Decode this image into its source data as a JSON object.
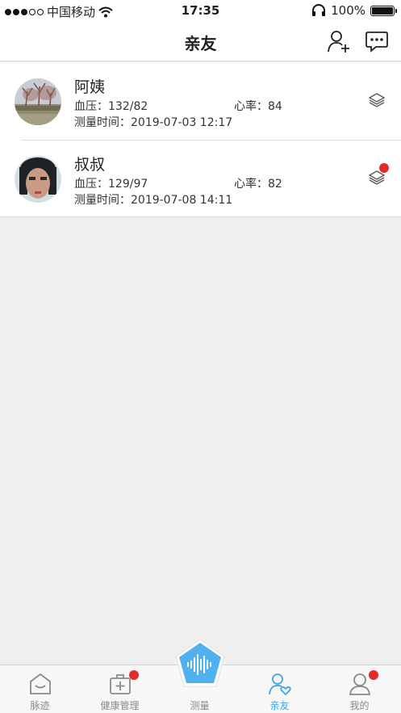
{
  "status": {
    "carrier": "中国移动",
    "time": "17:35",
    "battery": "100%"
  },
  "nav": {
    "title": "亲友"
  },
  "friends": [
    {
      "name": "阿姨",
      "bp": "血压：132/82",
      "hr": "心率：84",
      "time": "测量时间：2019-07-03 12:17"
    },
    {
      "name": "叔叔",
      "bp": "血压：129/97",
      "hr": "心率：82",
      "time": "测量时间：2019-07-08 14:11"
    }
  ],
  "tabs": [
    {
      "label": "脉迹"
    },
    {
      "label": "健康管理"
    },
    {
      "label": "测量"
    },
    {
      "label": "亲友"
    },
    {
      "label": "我的"
    }
  ],
  "colors": {
    "accent": "#3aa6e8",
    "badge": "#e32b2b",
    "background": "#efefef"
  }
}
